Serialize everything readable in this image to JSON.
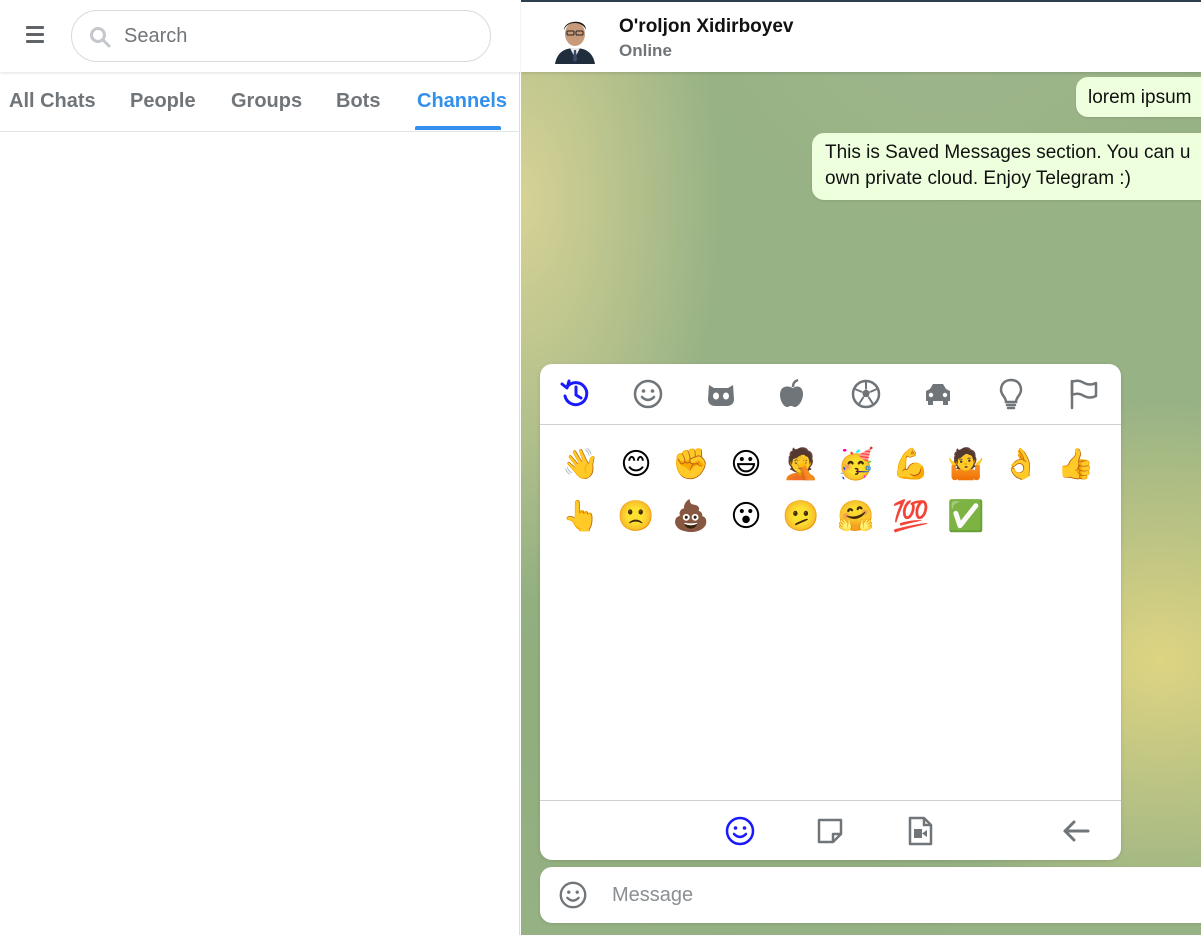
{
  "sidebar": {
    "search": {
      "placeholder": "Search"
    },
    "tabs": [
      {
        "label": "All Chats",
        "active": false
      },
      {
        "label": "People",
        "active": false
      },
      {
        "label": "Groups",
        "active": false
      },
      {
        "label": "Bots",
        "active": false
      },
      {
        "label": "Channels",
        "active": true
      }
    ]
  },
  "chat": {
    "name": "O'roljon Xidirboyev",
    "status": "Online",
    "messages": [
      {
        "text": "lorem ipsum"
      },
      {
        "line1": "This is Saved Messages section. You can u",
        "line2": "own private cloud. Enjoy Telegram :)"
      }
    ]
  },
  "emoji_picker": {
    "categories": [
      "recent-icon",
      "smiley-icon",
      "animals-icon",
      "food-icon",
      "activity-icon",
      "travel-icon",
      "objects-icon",
      "flags-icon"
    ],
    "active_category": "recent",
    "emojis": [
      "👋",
      "😊",
      "✊",
      "😃",
      "🤦",
      "🥳",
      "💪",
      "🤷",
      "👌",
      "👍",
      "👆",
      "🙁",
      "💩",
      "😮",
      "🫤",
      "🤗",
      "💯",
      "✅"
    ],
    "footer": [
      "emoji-tab-icon",
      "sticker-tab-icon",
      "gif-tab-icon",
      "back-icon"
    ]
  },
  "composer": {
    "placeholder": "Message"
  },
  "colors": {
    "accent": "#3390ec",
    "picker_active": "#1a1aff",
    "bubble": "#eeffde",
    "icon_gray": "#707579"
  }
}
